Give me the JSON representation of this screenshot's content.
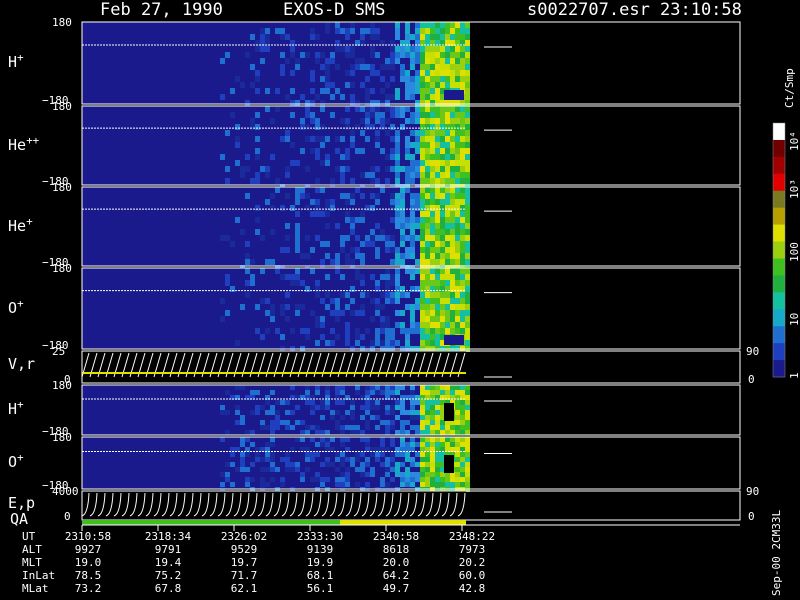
{
  "header": {
    "date": "Feb 27, 1990",
    "mission": "EXOS-D SMS",
    "file": "s0022707.esr",
    "time": "23:10:58"
  },
  "colorbar": {
    "unit": "Ct/Smp",
    "ticks": [
      "1",
      "10",
      "100",
      "10³",
      "10⁴"
    ],
    "colors": [
      "#1a1a8c",
      "#1f3fbf",
      "#1f6fd0",
      "#18a8c8",
      "#15c0a0",
      "#20b040",
      "#40c020",
      "#9ad010",
      "#e0e000",
      "#b8a000",
      "#7a7a20",
      "#e00000",
      "#a00000",
      "#700000",
      "#ffffff"
    ]
  },
  "panels": [
    {
      "label": "H",
      "sup": "+",
      "ymax": "180",
      "ymin": "−180"
    },
    {
      "label": "He",
      "sup": "++",
      "ymax": "180",
      "ymin": "−180"
    },
    {
      "label": "He",
      "sup": "+",
      "ymax": "180",
      "ymin": "−180"
    },
    {
      "label": "O",
      "sup": "+",
      "ymax": "180",
      "ymin": "−180"
    },
    {
      "label": "V,r",
      "sup": "",
      "ymax": "25",
      "ymin": "0",
      "rmax": "90",
      "rmin": "0"
    },
    {
      "label": "H",
      "sup": "+",
      "ymax": "180",
      "ymin": "−180"
    },
    {
      "label": "O",
      "sup": "+",
      "ymax": "180",
      "ymin": "−180"
    },
    {
      "label": "E,p",
      "sup": "",
      "ymax": "4000",
      "ymin": "0",
      "rmax": "90",
      "rmin": "0"
    }
  ],
  "qa_label": "QA",
  "footer": {
    "rows": [
      {
        "name": "UT",
        "values": [
          "2310:58",
          "2318:34",
          "2326:02",
          "2333:30",
          "2340:58",
          "2348:22"
        ]
      },
      {
        "name": "ALT",
        "values": [
          "9927",
          "9791",
          "9529",
          "9139",
          "8618",
          "7973"
        ]
      },
      {
        "name": "MLT",
        "values": [
          "19.0",
          "19.4",
          "19.7",
          "19.9",
          "20.0",
          "20.2"
        ]
      },
      {
        "name": "InLat",
        "values": [
          "78.5",
          "75.2",
          "71.7",
          "68.1",
          "64.2",
          "60.0"
        ]
      },
      {
        "name": "MLat",
        "values": [
          "73.2",
          "67.8",
          "62.1",
          "56.1",
          "49.7",
          "42.8"
        ]
      }
    ],
    "footnote": "Sep-00 2CM33L"
  },
  "chart_data": {
    "type": "heatmap",
    "title": "Feb 27, 1990   EXOS-D SMS",
    "x_ticks": [
      "2310:58",
      "2318:34",
      "2326:02",
      "2333:30",
      "2340:58",
      "2348:22"
    ],
    "colorbar_scale": "log",
    "colorbar_range": [
      1,
      10000
    ]
  }
}
